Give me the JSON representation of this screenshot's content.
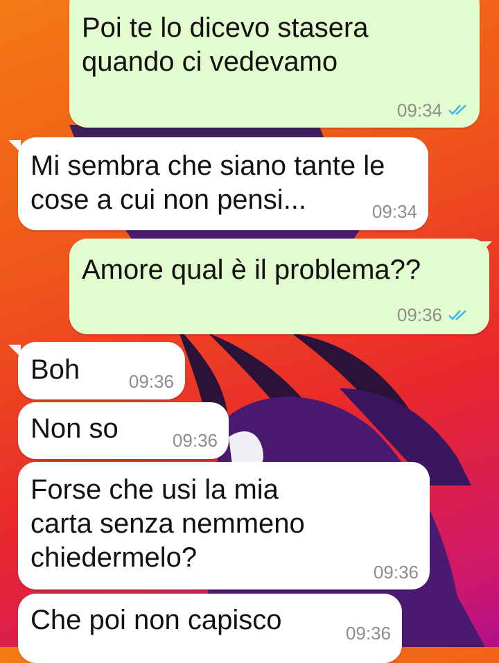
{
  "colors": {
    "outgoing_bubble": "#e2fbcf",
    "incoming_bubble": "#ffffff",
    "read_ticks": "#34b7f1",
    "timestamp": "#8d8d8d"
  },
  "messages": [
    {
      "direction": "outgoing",
      "text": "Poi te lo dicevo stasera\nquando ci vedevamo",
      "time": "09:34",
      "status_icon": "double-check-read-icon"
    },
    {
      "direction": "incoming",
      "text": "Mi sembra che siano tante le\ncose a cui non pensi...",
      "time": "09:34"
    },
    {
      "direction": "outgoing",
      "text": "Amore qual è il problema??",
      "time": "09:36",
      "status_icon": "double-check-read-icon"
    },
    {
      "direction": "incoming",
      "text": "Boh",
      "time": "09:36"
    },
    {
      "direction": "incoming",
      "text": "Non so",
      "time": "09:36"
    },
    {
      "direction": "incoming",
      "text": "Forse che usi la mia\ncarta senza nemmeno\nchiedermelo?",
      "time": "09:36"
    },
    {
      "direction": "incoming",
      "text": "Che poi non capisco",
      "time": "09:36"
    }
  ]
}
